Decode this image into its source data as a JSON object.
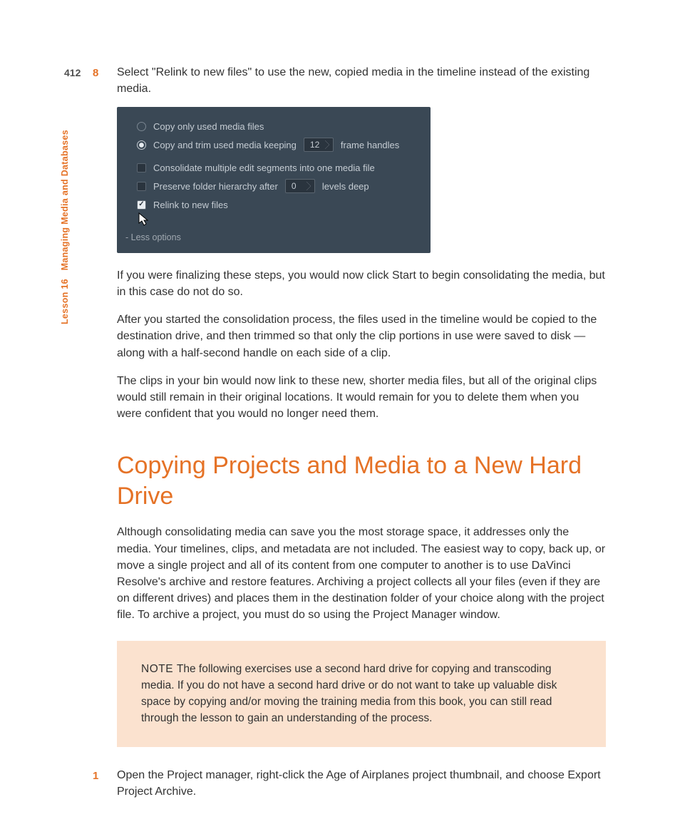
{
  "page_number": "412",
  "sidebar": {
    "lesson": "Lesson 16",
    "title": "Managing Media and Databases"
  },
  "step8": {
    "num": "8",
    "text": "Select \"Relink to new files\" to use the new, copied media in the timeline instead of the existing media."
  },
  "screenshot": {
    "opt1": "Copy only used media files",
    "opt2_pre": "Copy and trim used media keeping",
    "opt2_val": "12",
    "opt2_post": "frame handles",
    "chk1": "Consolidate multiple edit segments into one media file",
    "chk2_pre": "Preserve folder hierarchy after",
    "chk2_val": "0",
    "chk2_post": "levels deep",
    "chk3": "Relink to new files",
    "less": "- Less options"
  },
  "para1": "If you were finalizing these steps, you would now click Start to begin consolidating the media, but in this case do not do so.",
  "para2": "After you started the consolidation process, the files used in the timeline would be copied to the destination drive, and then trimmed so that only the clip portions in use were saved to disk —along with a half-second handle on each side of a clip.",
  "para3": "The clips in your bin would now link to these new, shorter media files, but all of the original clips would still remain in their original locations. It would remain for you to delete them when you were confident that you would no longer need them.",
  "heading": "Copying Projects and Media to a New Hard Drive",
  "para4": "Although consolidating media can save you the most storage space, it addresses only the media. Your timelines, clips, and metadata are not included. The easiest way to copy, back up, or move a single project and all of its content from one computer to another is to use DaVinci Resolve's archive and restore features. Archiving a project collects all your files (even if they are on different drives) and places them in the destination folder of your choice along with the project file. To archive a project, you must do so using the Project Manager window.",
  "note": {
    "label": "NOTE ",
    "text": " The following exercises use a second hard drive for copying and transcoding media. If you do not have a second hard drive or do not want to take up valuable disk space by copying and/or moving the training media from this book, you can still read through the lesson to gain an understanding of the process."
  },
  "step1": {
    "num": "1",
    "text": "Open the Project manager, right-click the Age of Airplanes project thumbnail, and choose Export Project Archive."
  }
}
